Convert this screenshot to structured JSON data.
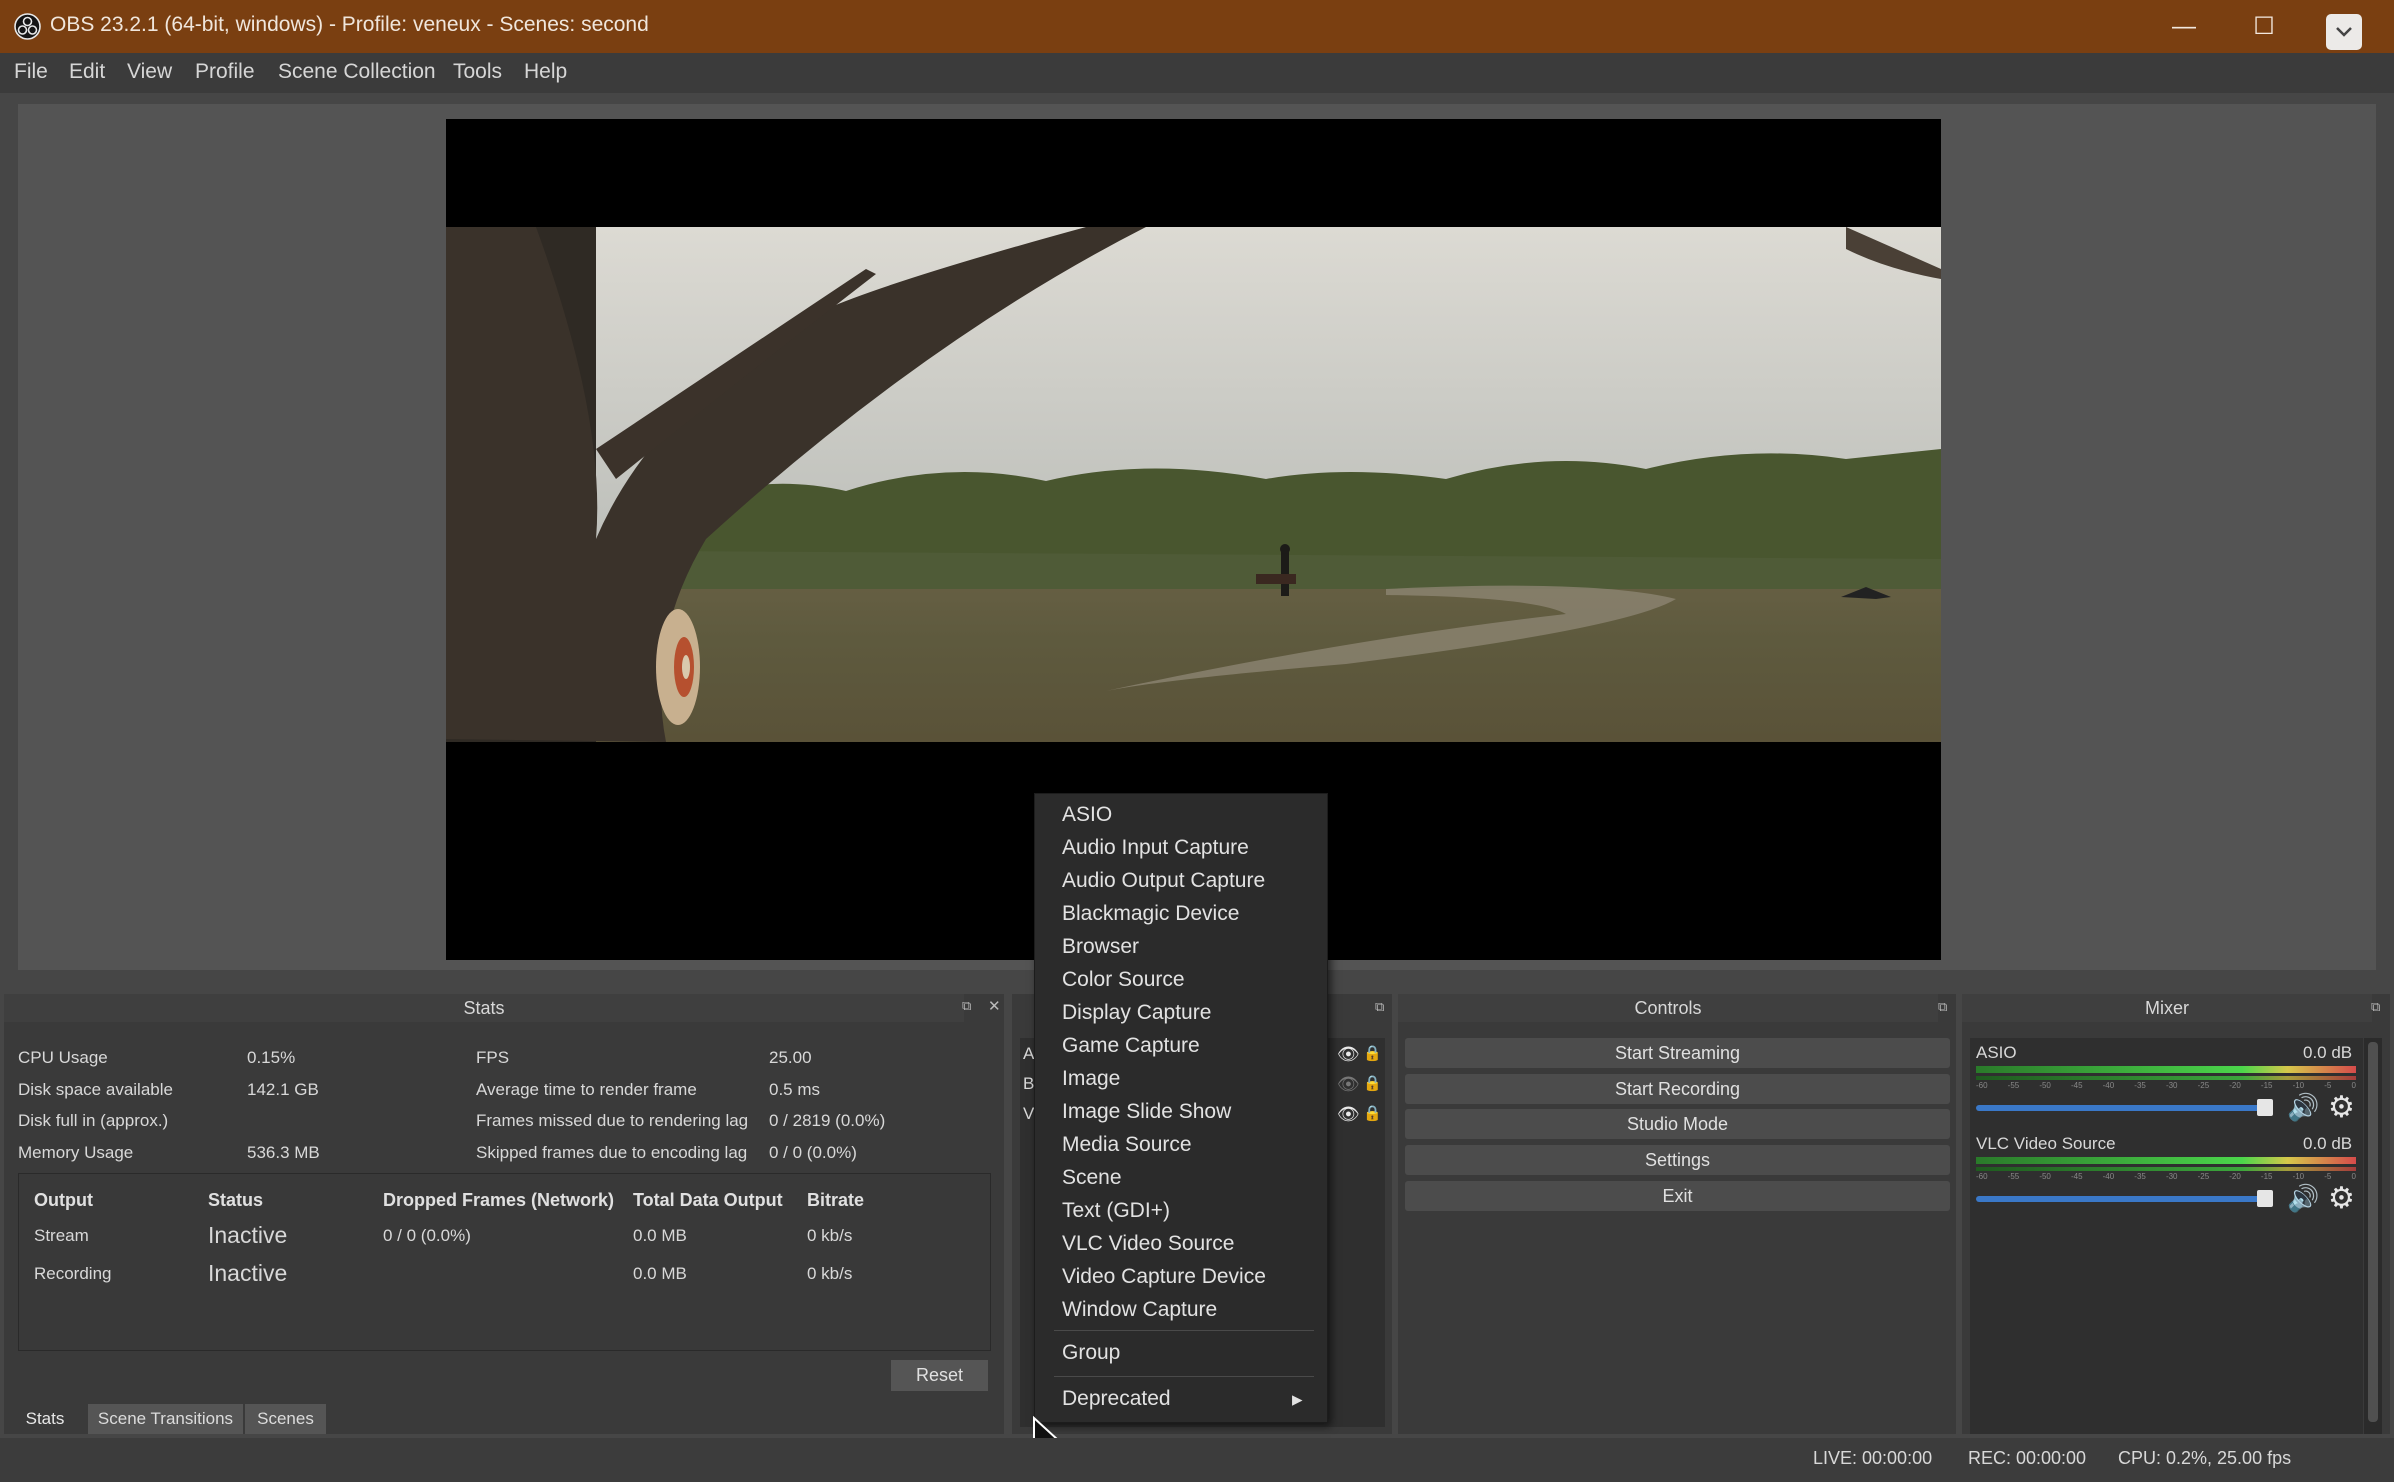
{
  "window": {
    "title": "OBS 23.2.1 (64-bit, windows) - Profile: veneux - Scenes: second",
    "minimize": "—",
    "maximize": "☐"
  },
  "menu": [
    "File",
    "Edit",
    "View",
    "Profile",
    "Scene Collection",
    "Tools",
    "Help"
  ],
  "stats": {
    "title": "Stats",
    "rows_left": [
      {
        "label": "CPU Usage",
        "value": "0.15%"
      },
      {
        "label": "Disk space available",
        "value": "142.1 GB"
      },
      {
        "label": "Disk full in (approx.)",
        "value": ""
      },
      {
        "label": "Memory Usage",
        "value": "536.3 MB"
      }
    ],
    "rows_right": [
      {
        "label": "FPS",
        "value": "25.00"
      },
      {
        "label": "Average time to render frame",
        "value": "0.5 ms"
      },
      {
        "label": "Frames missed due to rendering lag",
        "value": "0 / 2819 (0.0%)"
      },
      {
        "label": "Skipped frames due to encoding lag",
        "value": "0 / 0 (0.0%)"
      }
    ],
    "table_headers": [
      "Output",
      "Status",
      "Dropped Frames (Network)",
      "Total Data Output",
      "Bitrate"
    ],
    "table_rows": [
      [
        "Stream",
        "Inactive",
        "0 / 0 (0.0%)",
        "0.0 MB",
        "0 kb/s"
      ],
      [
        "Recording",
        "Inactive",
        "",
        "0.0 MB",
        "0 kb/s"
      ]
    ],
    "reset_label": "Reset"
  },
  "tabs": [
    "Stats",
    "Scene Transitions",
    "Scenes"
  ],
  "sources_partial": [
    "A",
    "B",
    "V"
  ],
  "controls": {
    "title": "Controls",
    "buttons": [
      "Start Streaming",
      "Start Recording",
      "Studio Mode",
      "Settings",
      "Exit"
    ]
  },
  "mixer": {
    "title": "Mixer",
    "channels": [
      {
        "name": "ASIO",
        "db": "0.0 dB",
        "level": 0.99
      },
      {
        "name": "VLC Video Source",
        "db": "0.0 dB",
        "level": 0.99
      }
    ],
    "scale": [
      "-60",
      "-55",
      "-50",
      "-45",
      "-40",
      "-35",
      "-30",
      "-25",
      "-20",
      "-15",
      "-10",
      "-5",
      "0"
    ]
  },
  "context_menu": {
    "items": [
      "ASIO",
      "Audio Input Capture",
      "Audio Output Capture",
      "Blackmagic Device",
      "Browser",
      "Color Source",
      "Display Capture",
      "Game Capture",
      "Image",
      "Image Slide Show",
      "Media Source",
      "Scene",
      "Text (GDI+)",
      "VLC Video Source",
      "Video Capture Device",
      "Window Capture"
    ],
    "group": "Group",
    "deprecated": "Deprecated",
    "arrow": "▸"
  },
  "statusbar": {
    "live": "LIVE: 00:00:00",
    "rec": "REC: 00:00:00",
    "cpu": "CPU: 0.2%, 25.00 fps"
  }
}
